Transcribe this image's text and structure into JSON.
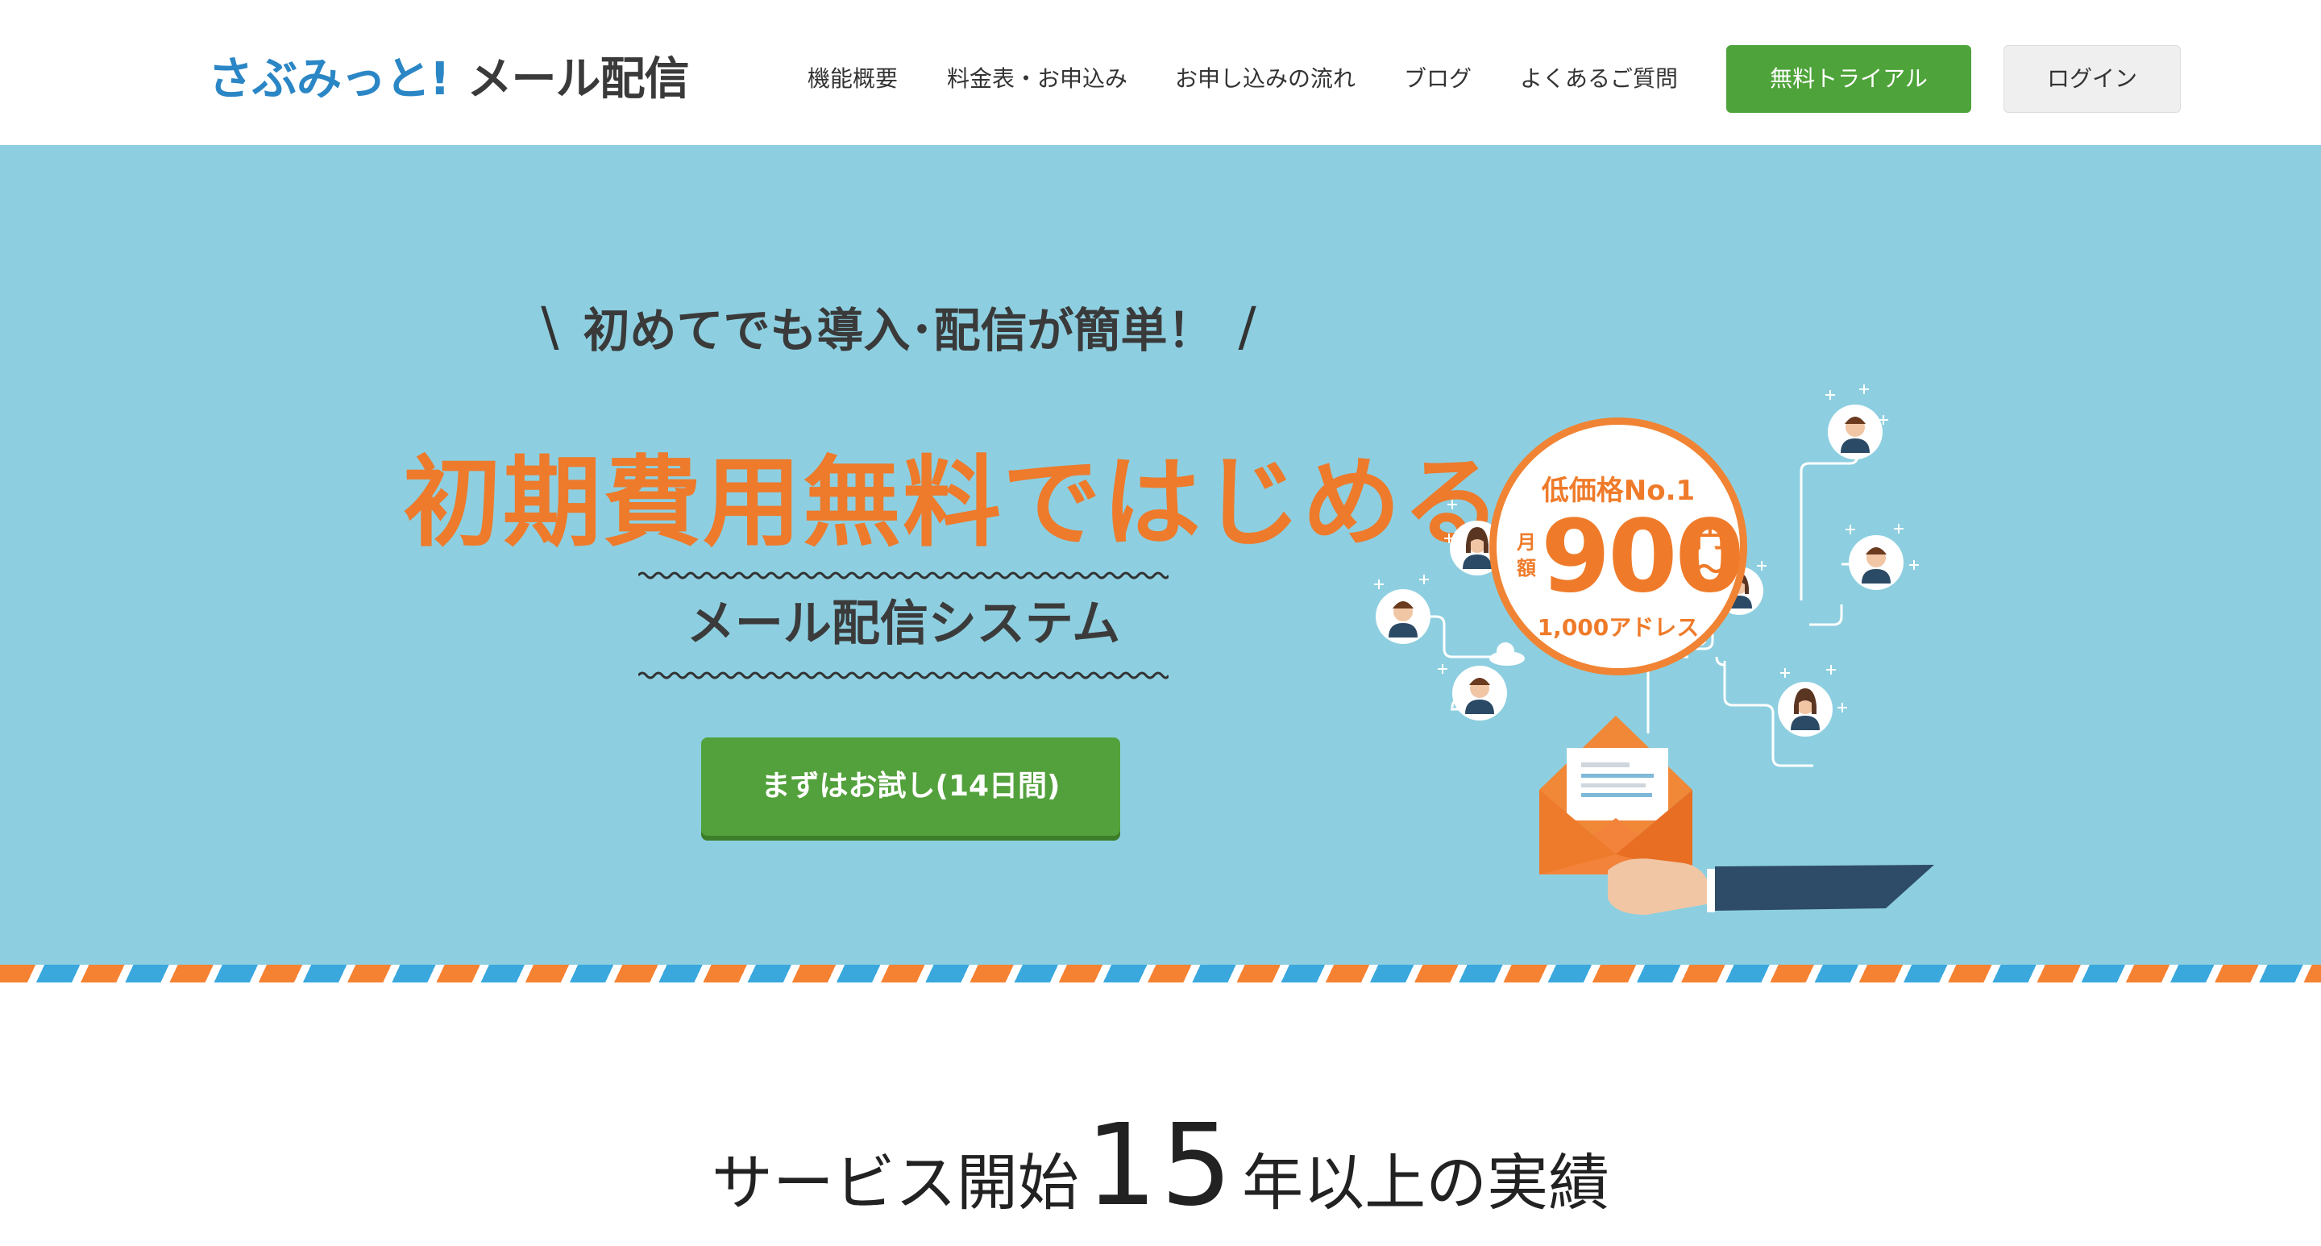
{
  "header": {
    "logo_part1": "さぶみっと!",
    "logo_part2": "メール配信",
    "nav": [
      {
        "label": "機能概要"
      },
      {
        "label": "料金表・お申込み"
      },
      {
        "label": "お申し込みの流れ"
      },
      {
        "label": "ブログ"
      },
      {
        "label": "よくあるご質問"
      }
    ],
    "trial_button": "無料トライアル",
    "login_button": "ログイン"
  },
  "hero": {
    "tagline": "初めてでも導入･配信が簡単！",
    "slash_left": "\\",
    "slash_right": "/",
    "headline": "初期費用無料ではじめる",
    "subtitle": "メール配信システム",
    "cta": "まずはお試し(14日間)",
    "badge": {
      "title": "低価格No.1",
      "monthly": "月額",
      "price": "900",
      "yen": "円",
      "tilde": "〜",
      "addresses": "1,000アドレス"
    }
  },
  "section": {
    "title_pre": "サービス開始",
    "title_number": "15",
    "title_post": "年以上の実績"
  },
  "colors": {
    "hero_bg": "#8dcfe0",
    "accent_orange": "#ee7a2b",
    "green": "#4ea33a",
    "logo_blue": "#2b86c5"
  }
}
